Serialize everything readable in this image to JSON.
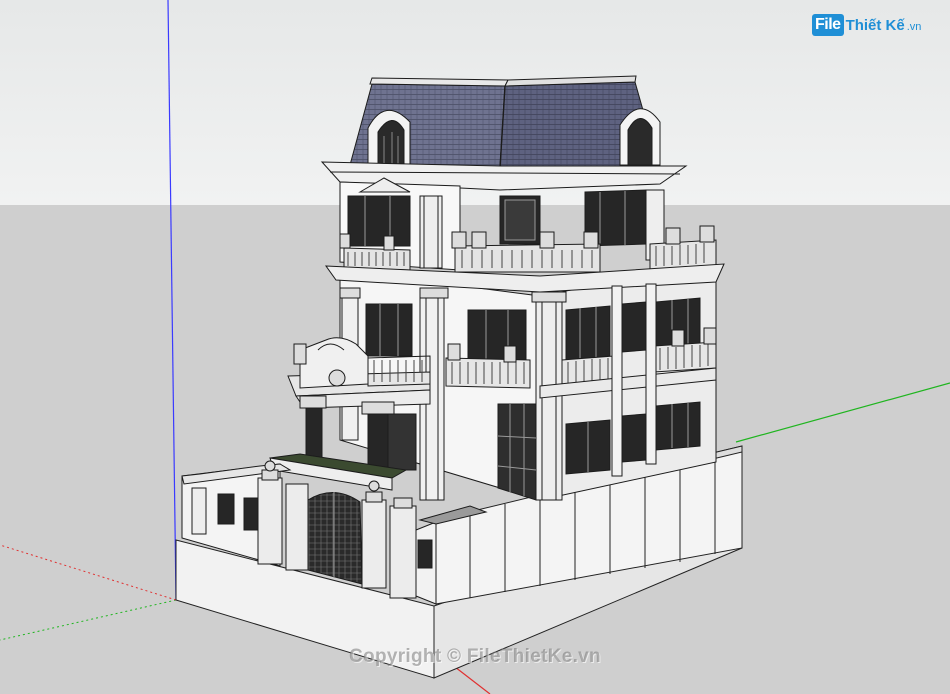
{
  "logo": {
    "box": "File",
    "rest": "Thiết Kế",
    "tld": ".vn"
  },
  "watermark": "Copyright © FileThietKe.vn",
  "colors": {
    "sky": "#e8eaea",
    "ground": "#cfcfcf",
    "axis_blue": "#3a3aff",
    "axis_green": "#1fb51f",
    "axis_red": "#e03030",
    "roof": "#6b6f8a",
    "wall": "#f4f4f4",
    "dark": "#1c1c1c",
    "logo": "#1f8fd6"
  }
}
